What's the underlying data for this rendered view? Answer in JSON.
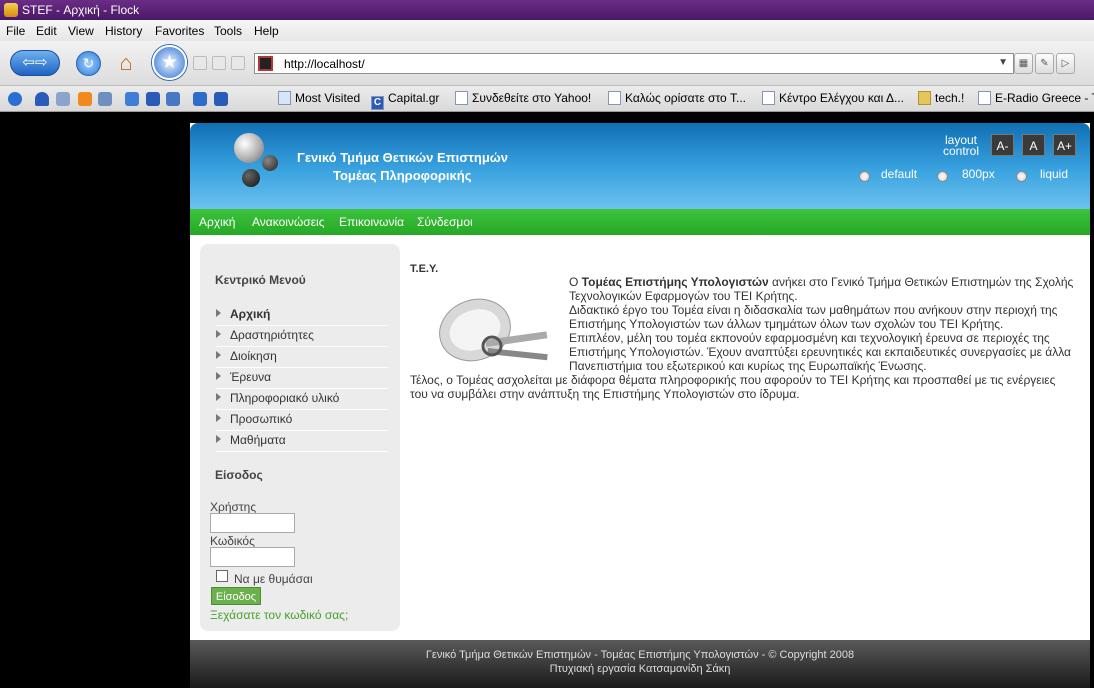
{
  "window": {
    "title": "STEF - Αρχική - Flock"
  },
  "menubar": [
    "File",
    "Edit",
    "View",
    "History",
    "Favorites",
    "Tools",
    "Help"
  ],
  "addressbar": {
    "url": "http://localhost/"
  },
  "bookmarks": [
    {
      "label": "Most Visited",
      "icon": "folder-icon"
    },
    {
      "label": "Capital.gr",
      "icon": "capital-icon"
    },
    {
      "label": "Συνδεθείτε στο Yahoo!",
      "icon": "page-icon"
    },
    {
      "label": "Καλώς ορίσατε στο T...",
      "icon": "page-icon"
    },
    {
      "label": "Κέντρο Ελέγχου και Δ...",
      "icon": "page-icon"
    },
    {
      "label": "tech.!",
      "icon": "folder-icon"
    },
    {
      "label": "E-Radio Greece - T",
      "icon": "page-icon"
    }
  ],
  "site": {
    "header": {
      "title_line1": "Γενικό Τμήμα Θετικών Επιστημών",
      "title_line2": "Τομέας Πληροφορικής",
      "layout_label_1": "layout",
      "layout_label_2": "control",
      "size_buttons": [
        "A-",
        "A",
        "A+"
      ],
      "layout_options": [
        "default",
        "800px",
        "liquid"
      ]
    },
    "nav": [
      "Αρχική",
      "Ανακοινώσεις",
      "Επικοινωνία",
      "Σύνδεσμοι"
    ],
    "sidebar": {
      "menu_title": "Κεντρικό Μενού",
      "items": [
        "Αρχική",
        "Δραστηριότητες",
        "Διοίκηση",
        "Έρευνα",
        "Πληροφοριακό υλικό",
        "Προσωπικό",
        "Μαθήματα"
      ],
      "login_title": "Είσοδος",
      "user_label": "Χρήστης",
      "pass_label": "Κωδικός",
      "remember_label": "Να με θυμάσαι",
      "login_button": "Είσοδος",
      "forgot_link": "Ξεχάσατε τον κωδικό σας;"
    },
    "content": {
      "title": "Τ.Ε.Υ.",
      "intro_prefix": "Ο ",
      "intro_bold": "Τομέας Επιστήμης Υπολογιστών",
      "intro_rest": " ανήκει στο Γενικό Τμήμα Θετικών Επιστημών της Σχολής Τεχνολογικών Εφαρμογών του ΤΕΙ Κρήτης.",
      "para2": "Διδακτικό έργο του Τομέα είναι η διδασκαλία των μαθημάτων που ανήκουν στην περιοχή της Επιστήμης Υπολογιστών των άλλων τμημάτων όλων των σχολών του ΤΕΙ Κρήτης.",
      "para3": "Επιπλέον, μέλη του τομέα εκπονούν εφαρμοσμένη και τεχνολογική έρευνα σε περιοχές της Επιστήμης Υπολογιστών. Έχουν αναπτύξει ερευνητικές και εκπαιδευτικές συνεργασίες με άλλα Πανεπιστήμια του εξωτερικού και κυρίως της Ευρωπαϊκής Ένωσης.",
      "para4": "Τέλος, ο Τομέας ασχολείται με διάφορα θέματα πληροφορικής που αφορούν το ΤΕΙ Κρήτης και προσπαθεί με τις ενέργειες του να συμβάλει στην ανάπτυξη της Επιστήμης Υπολογιστών στο ίδρυμα."
    },
    "footer": {
      "line1": "Γενικό Τμήμα Θετικών Επιστημών - Τομέας Επιστήμης Υπολογιστών - © Copyright 2008",
      "line2": "Πτυχιακή εργασία Κατσαμανίδη Σάκη"
    }
  }
}
